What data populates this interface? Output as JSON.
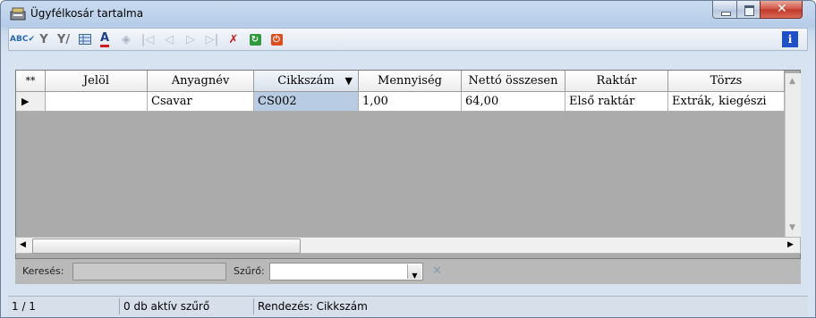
{
  "window": {
    "title": "Ügyfélkosár tartalma"
  },
  "grid": {
    "corner": "**",
    "columns": [
      "Jelöl",
      "Anyagnév",
      "Cikkszám",
      "Mennyiség",
      "Nettó összesen",
      "Raktár",
      "Törzs"
    ],
    "sorted_column": "Cikkszám",
    "row": {
      "indicator": "▶",
      "jelol": "",
      "anyagnev": "Csavar",
      "cikkszam": "CS002",
      "mennyiseg": "1,00",
      "netto": "64,00",
      "raktar": "Első raktár",
      "torzs": "Extrák, kiegészi"
    }
  },
  "search": {
    "label": "Keresés:",
    "value": ""
  },
  "filter": {
    "label": "Szűrő:",
    "value": ""
  },
  "status": {
    "page": "1 / 1",
    "filters": "0 db aktív szűrő",
    "sort": "Rendezés: Cikkszám"
  },
  "icons": [
    "spellcheck-icon",
    "filter-icon",
    "filter-edit-icon",
    "grid-icon",
    "font-color-icon",
    "eraser-icon",
    "first-record-icon",
    "prev-record-icon",
    "next-record-icon",
    "last-record-icon",
    "delete-record-icon",
    "refresh-icon",
    "stop-icon",
    "info-icon"
  ]
}
